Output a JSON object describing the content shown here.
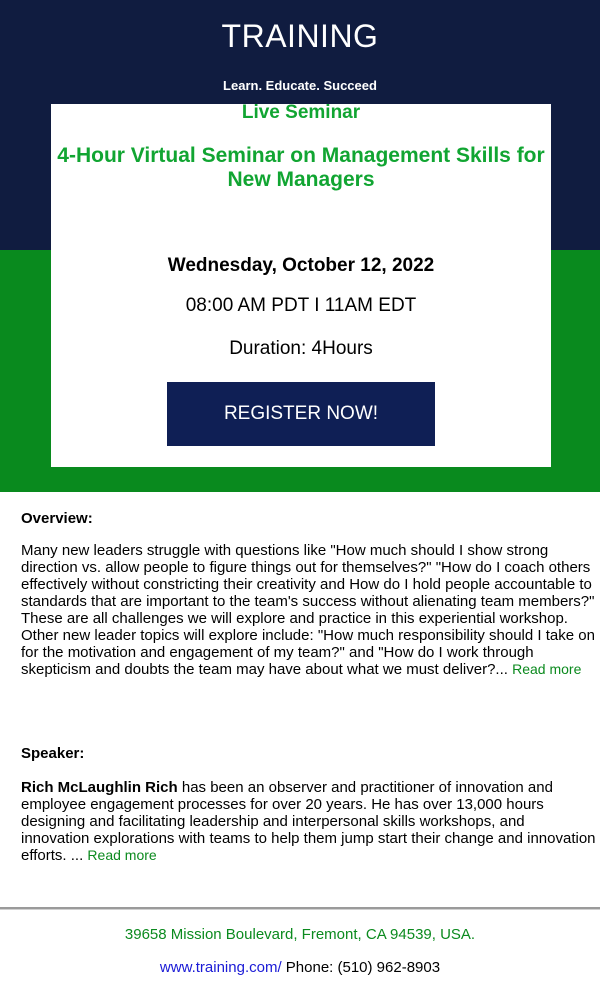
{
  "header": {
    "title": "TRAINING",
    "tagline": "Learn. Educate. Succeed"
  },
  "card": {
    "kicker": "Live Seminar",
    "title": "4-Hour Virtual Seminar on Management Skills for New Managers",
    "date": "Wednesday, October 12, 2022",
    "time": "08:00 AM PDT I 11AM EDT",
    "duration": "Duration: 4Hours",
    "register_label": "REGISTER NOW!"
  },
  "overview": {
    "heading": "Overview:",
    "body": "Many new leaders struggle with questions like \"How much should I show strong direction vs. allow people to figure things out for themselves?\" \"How do I coach others effectively without constricting their creativity and How do I hold people accountable to standards that are important to the team's success without alienating team members?\" These are all challenges we will explore and practice in this experiential workshop. Other new leader topics will explore include: \"How much responsibility should I take on for the motivation and engagement of my team?\" and \"How do I work through skepticism and doubts the team may have about what we must deliver?...",
    "read_more": "Read more"
  },
  "speaker": {
    "heading": "Speaker:",
    "name": "Rich McLaughlin Rich",
    "body": " has been an observer and practitioner of innovation and employee engagement processes for over 20 years. He has over 13,000 hours designing and facilitating leadership and interpersonal skills workshops, and innovation explorations with teams to help them jump start their change and innovation efforts. ...",
    "read_more": "Read more"
  },
  "footer": {
    "address": "39658 Mission Boulevard, Fremont, CA 94539, USA.",
    "website": "www.training.com/",
    "phone": " Phone: (510) 962-8903"
  },
  "colors": {
    "navy": "#101c40",
    "green": "#098a1e",
    "accent_green": "#11a532",
    "button": "#0f1f55"
  }
}
